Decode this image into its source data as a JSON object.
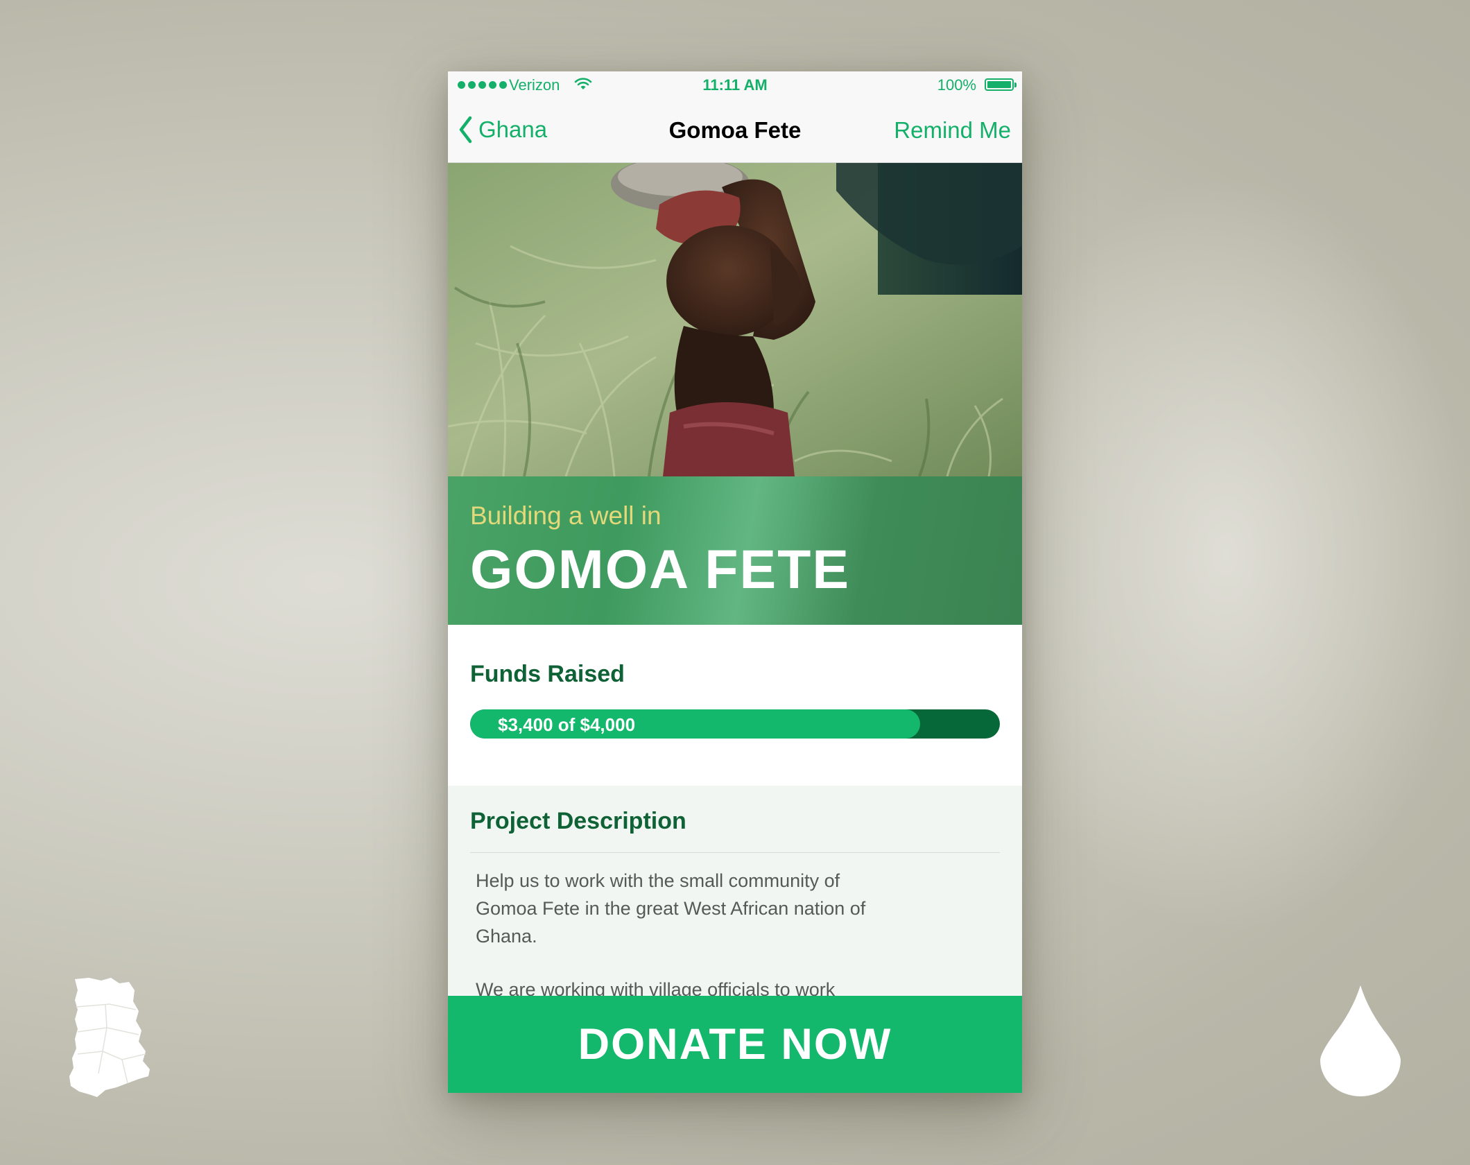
{
  "status_bar": {
    "carrier": "Verizon",
    "time": "11:11 AM",
    "battery": "100%"
  },
  "nav": {
    "back_label": "Ghana",
    "title": "Gomoa Fete",
    "action_label": "Remind Me"
  },
  "banner": {
    "subtitle": "Building a well in",
    "title": "GOMOA FETE"
  },
  "funds": {
    "heading": "Funds Raised",
    "progress_text": "$3,400 of $4,000",
    "raised": 3400,
    "goal": 4000
  },
  "description": {
    "heading": "Project Description",
    "paragraph1": "Help us to work with the small community of Gomoa Fete in the great West African nation of Ghana.",
    "paragraph2": "We are working with village officials to work"
  },
  "donate_button": "DONATE NOW",
  "colors": {
    "accent": "#14b06a",
    "dark_green": "#066738",
    "heading_green": "#0f6236",
    "banner_subtitle": "#e3d97a"
  },
  "icons": [
    "signal-dots-icon",
    "wifi-icon",
    "battery-icon",
    "chevron-left-icon",
    "ghana-map-icon",
    "water-drop-icon"
  ]
}
